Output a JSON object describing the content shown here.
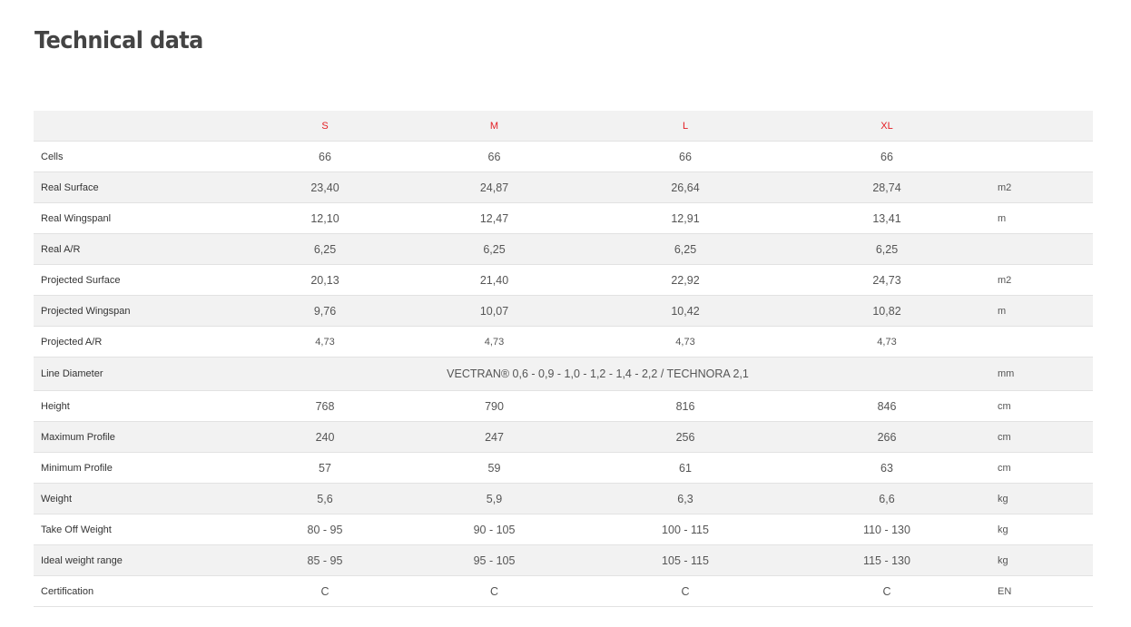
{
  "page": {
    "title": "Technical data"
  },
  "colors": {
    "accent": "#e31e24",
    "row_alt": "#f2f2f2",
    "text": "#444444"
  },
  "table": {
    "sizes": [
      "S",
      "M",
      "L",
      "XL"
    ],
    "rows": [
      {
        "label": "Cells",
        "values": [
          "66",
          "66",
          "66",
          "66"
        ],
        "unit": ""
      },
      {
        "label": "Real Surface",
        "values": [
          "23,40",
          "24,87",
          "26,64",
          "28,74"
        ],
        "unit": "m2"
      },
      {
        "label": "Real Wingspanl",
        "values": [
          "12,10",
          "12,47",
          "12,91",
          "13,41"
        ],
        "unit": "m"
      },
      {
        "label": "Real A/R",
        "values": [
          "6,25",
          "6,25",
          "6,25",
          "6,25"
        ],
        "unit": ""
      },
      {
        "label": "Projected Surface",
        "values": [
          "20,13",
          "21,40",
          "22,92",
          "24,73"
        ],
        "unit": "m2"
      },
      {
        "label": "Projected Wingspan",
        "values": [
          "9,76",
          "10,07",
          "10,42",
          "10,82"
        ],
        "unit": "m"
      },
      {
        "label": "Projected A/R",
        "values": [
          "4,73",
          "4,73",
          "4,73",
          "4,73"
        ],
        "unit": ""
      },
      {
        "label": "Line Diameter",
        "span_value": "VECTRAN® 0,6 - 0,9 - 1,0 - 1,2 - 1,4 - 2,2  /  TECHNORA 2,1",
        "unit": "mm"
      },
      {
        "label": "Height",
        "values": [
          "768",
          "790",
          "816",
          "846"
        ],
        "unit": "cm"
      },
      {
        "label": "Maximum Profile",
        "values": [
          "240",
          "247",
          "256",
          "266"
        ],
        "unit": "cm"
      },
      {
        "label": "Minimum Profile",
        "values": [
          "57",
          "59",
          "61",
          "63"
        ],
        "unit": "cm"
      },
      {
        "label": "Weight",
        "values": [
          "5,6",
          "5,9",
          "6,3",
          "6,6"
        ],
        "unit": "kg"
      },
      {
        "label": "Take Off Weight",
        "values": [
          "80 - 95",
          "90 - 105",
          "100 - 115",
          "110 - 130"
        ],
        "unit": "kg"
      },
      {
        "label": "Ideal weight range",
        "values": [
          "85 - 95",
          "95 - 105",
          "105 - 115",
          "115 - 130"
        ],
        "unit": "kg"
      },
      {
        "label": "Certification",
        "values": [
          "C",
          "C",
          "C",
          "C"
        ],
        "unit": "EN"
      }
    ]
  }
}
